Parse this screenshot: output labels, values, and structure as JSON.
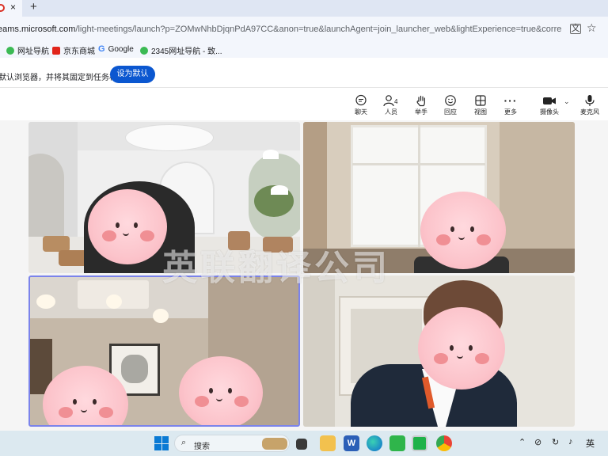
{
  "browser": {
    "close_tab": "×",
    "new_tab": "+",
    "url_host": "eams.microsoft.com",
    "url_rest": "/light-meetings/launch?p=ZOMwNhbDjqnPdA97CC&anon=true&launchAgent=join_launcher_web&lightExperience=true&correlationId...",
    "translate_icon": "translate-icon",
    "star_icon": "star-icon",
    "bookmarks": [
      {
        "label": "网址导航",
        "color": "#3cba54"
      },
      {
        "label": "京东商城",
        "color": "#e1251b"
      },
      {
        "label": "Google",
        "color": "#4285f4"
      },
      {
        "label": "2345网址导航 - 致...",
        "color": "#3cba54"
      }
    ],
    "infobar_text": "默认浏览器，并将其固定到任务栏",
    "set_default_button": "设为默认"
  },
  "meeting_toolbar": {
    "chat": {
      "icon": "chat-icon",
      "label": "聊天"
    },
    "people": {
      "icon": "people-icon",
      "label": "人员",
      "count": "4"
    },
    "raise_hand": {
      "icon": "hand-icon",
      "label": "举手"
    },
    "react": {
      "icon": "smile-icon",
      "label": "回应"
    },
    "view": {
      "icon": "grid-icon",
      "label": "视图"
    },
    "more": {
      "icon": "more-icon",
      "label": "更多"
    },
    "camera": {
      "icon": "camera-icon",
      "label": "摄像头"
    },
    "mic": {
      "icon": "mic-icon",
      "label": "麦克风"
    }
  },
  "watermark": "英联翻译公司",
  "taskbar": {
    "search_label": "搜索",
    "ime": "英"
  },
  "colors": {
    "accent": "#0b57d0",
    "active_speaker_border": "#7b83eb"
  }
}
